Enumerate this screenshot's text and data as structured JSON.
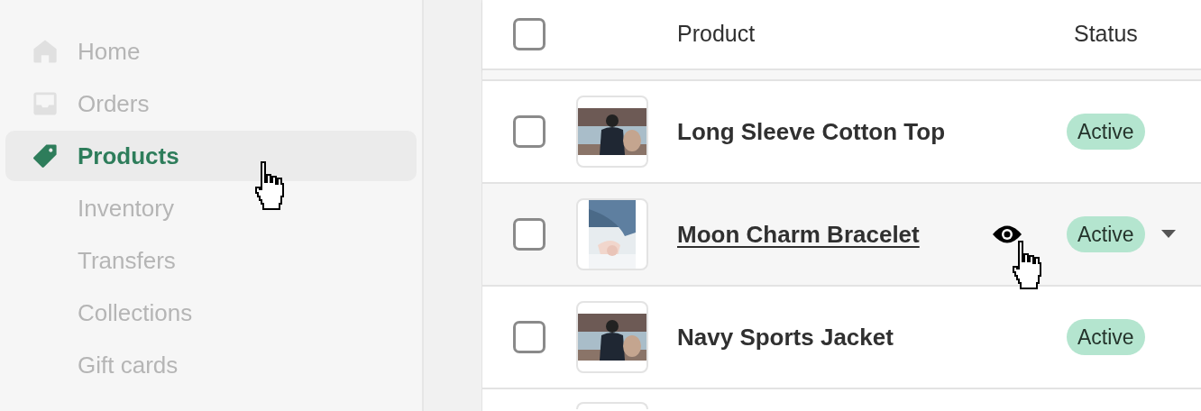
{
  "sidebar": {
    "items": [
      {
        "label": "Home",
        "selected": false,
        "dimmed": true
      },
      {
        "label": "Orders",
        "selected": false,
        "dimmed": true
      },
      {
        "label": "Products",
        "selected": true,
        "dimmed": false,
        "children": [
          {
            "label": "Inventory",
            "selected": false,
            "dimmed": true
          },
          {
            "label": "Transfers",
            "selected": false,
            "dimmed": true
          },
          {
            "label": "Collections",
            "selected": false,
            "dimmed": true
          },
          {
            "label": "Gift cards",
            "selected": false,
            "dimmed": true
          }
        ]
      }
    ]
  },
  "table": {
    "columns": [
      "Product",
      "Status"
    ],
    "header_checkbox": {
      "checked": false
    },
    "rows": [
      {
        "product": "Long Sleeve Cotton Top",
        "status": "Active",
        "checked": false,
        "hovered": false
      },
      {
        "product": "Moon Charm Bracelet",
        "status": "Active",
        "checked": false,
        "hovered": true
      },
      {
        "product": "Navy Sports Jacket",
        "status": "Active",
        "checked": false,
        "hovered": false
      }
    ]
  }
}
